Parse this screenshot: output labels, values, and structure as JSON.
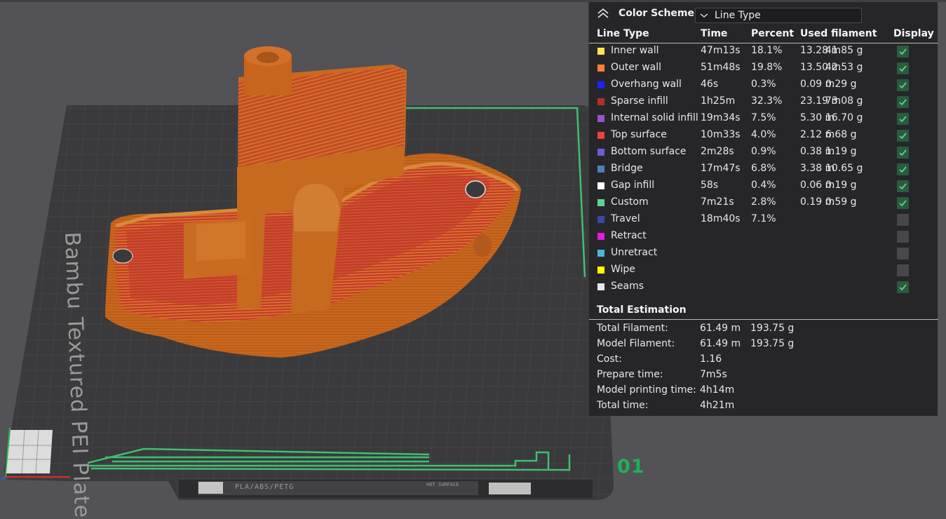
{
  "viewport": {
    "plate_label": "Bambu Textured PEI Plate",
    "plate_number": "01",
    "plate_tag": "PLA/ABS/PETG",
    "surface_tag": "HOT SURFACE",
    "model_color": "#c96a1e",
    "plate_color": "#3a3a3c"
  },
  "legend": {
    "title": "Color Scheme",
    "scheme_value": "Line Type",
    "columns": {
      "type": "Line Type",
      "time": "Time",
      "percent": "Percent",
      "used": "Used filament",
      "display": "Display"
    },
    "rows": [
      {
        "name": "Inner wall",
        "color": "#ffe64d",
        "time": "47m13s",
        "percent": "18.1%",
        "length": "13.28 m",
        "weight": "41.85 g",
        "display": true
      },
      {
        "name": "Outer wall",
        "color": "#ff7d38",
        "time": "51m48s",
        "percent": "19.8%",
        "length": "13.50 m",
        "weight": "42.53 g",
        "display": true
      },
      {
        "name": "Overhang wall",
        "color": "#1f1fff",
        "time": "46s",
        "percent": "0.3%",
        "length": "0.09 m",
        "weight": "0.29 g",
        "display": true
      },
      {
        "name": "Sparse infill",
        "color": "#b03029",
        "time": "1h25m",
        "percent": "32.3%",
        "length": "23.19 m",
        "weight": "73.08 g",
        "display": true
      },
      {
        "name": "Internal solid infill",
        "color": "#9654cc",
        "time": "19m34s",
        "percent": "7.5%",
        "length": "5.30 m",
        "weight": "16.70 g",
        "display": true
      },
      {
        "name": "Top surface",
        "color": "#f04040",
        "time": "10m33s",
        "percent": "4.0%",
        "length": "2.12 m",
        "weight": "6.68 g",
        "display": true
      },
      {
        "name": "Bottom surface",
        "color": "#7359d9",
        "time": "2m28s",
        "percent": "0.9%",
        "length": "0.38 m",
        "weight": "1.19 g",
        "display": true
      },
      {
        "name": "Bridge",
        "color": "#4d80ba",
        "time": "17m47s",
        "percent": "6.8%",
        "length": "3.38 m",
        "weight": "10.65 g",
        "display": true
      },
      {
        "name": "Gap infill",
        "color": "#ffffff",
        "time": "58s",
        "percent": "0.4%",
        "length": "0.06 m",
        "weight": "0.19 g",
        "display": true
      },
      {
        "name": "Custom",
        "color": "#5ed194",
        "time": "7m21s",
        "percent": "2.8%",
        "length": "0.19 m",
        "weight": "0.59 g",
        "display": true
      },
      {
        "name": "Travel",
        "color": "#3848a8",
        "time": "18m40s",
        "percent": "7.1%",
        "length": "",
        "weight": "",
        "display": false
      },
      {
        "name": "Retract",
        "color": "#e619e6",
        "time": "",
        "percent": "",
        "length": "",
        "weight": "",
        "display": false
      },
      {
        "name": "Unretract",
        "color": "#4db3d9",
        "time": "",
        "percent": "",
        "length": "",
        "weight": "",
        "display": false
      },
      {
        "name": "Wipe",
        "color": "#ffff00",
        "time": "",
        "percent": "",
        "length": "",
        "weight": "",
        "display": false
      },
      {
        "name": "Seams",
        "color": "#e6e6e6",
        "time": "",
        "percent": "",
        "length": "",
        "weight": "",
        "display": true
      }
    ],
    "total_title": "Total Estimation",
    "totals": [
      {
        "key": "Total Filament:",
        "v1": "61.49 m",
        "v2": "193.75 g"
      },
      {
        "key": "Model Filament:",
        "v1": "61.49 m",
        "v2": "193.75 g"
      },
      {
        "key": "Cost:",
        "v1": "1.16",
        "v2": ""
      },
      {
        "key": "Prepare time:",
        "v1": "7m5s",
        "v2": ""
      },
      {
        "key": "Model printing time:",
        "v1": "4h14m",
        "v2": ""
      },
      {
        "key": "Total time:",
        "v1": "4h21m",
        "v2": ""
      }
    ]
  }
}
